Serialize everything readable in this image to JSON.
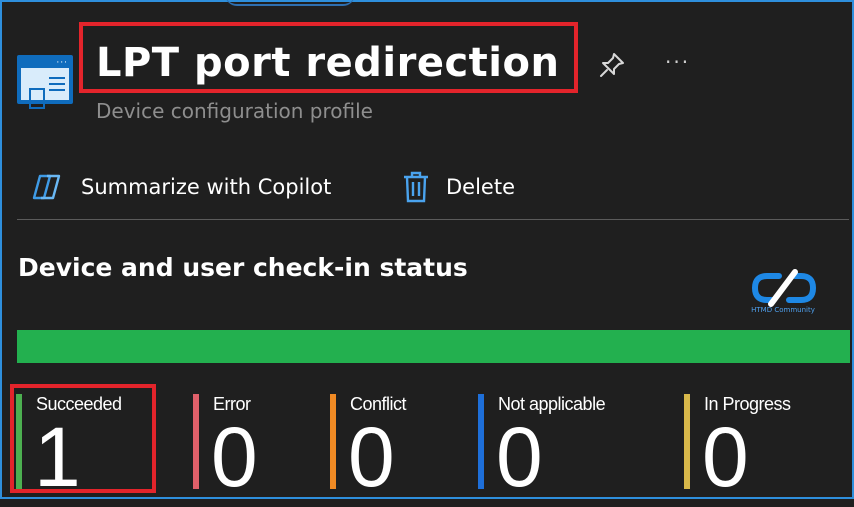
{
  "header": {
    "title": "LPT port redirection",
    "subtitle": "Device configuration profile",
    "more_label": "···"
  },
  "toolbar": {
    "copilot_label": "Summarize with Copilot",
    "delete_label": "Delete"
  },
  "checkin": {
    "title": "Device and user check-in status",
    "logo_text": "HTMD Community",
    "progress_fraction": 1.0,
    "stats": [
      {
        "label": "Succeeded",
        "value": "1",
        "color": "#4caf50"
      },
      {
        "label": "Error",
        "value": "0",
        "color": "#e0606a"
      },
      {
        "label": "Conflict",
        "value": "0",
        "color": "#f08a24"
      },
      {
        "label": "Not applicable",
        "value": "0",
        "color": "#1e6fd9"
      },
      {
        "label": "In Progress",
        "value": "0",
        "color": "#d8b84a"
      }
    ]
  },
  "colors": {
    "accent": "#2e8fdc",
    "highlight": "#e3242b",
    "success": "#23b04f"
  }
}
